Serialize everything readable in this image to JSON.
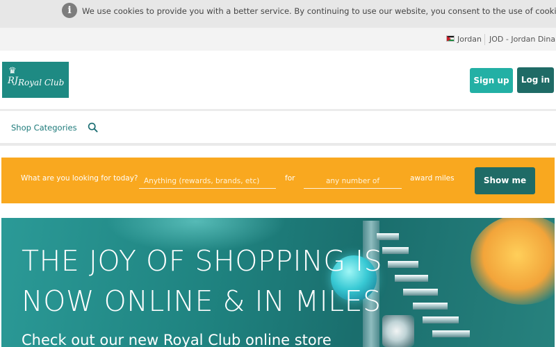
{
  "cookie_bar": {
    "icon": "info-icon",
    "text": "We use cookies to provide you with a better service. By continuing to use our website, you consent to the use of cookies."
  },
  "locale": {
    "country": "Jordan",
    "flag_icon": "jordan-flag-icon",
    "currency": "JOD - Jordan Dinars"
  },
  "header": {
    "logo_text": "Royal Club",
    "logo_monogram": "RJ",
    "signup_label": "Sign up",
    "login_label": "Log in"
  },
  "nav": {
    "shop_categories_label": "Shop Categories",
    "search_icon": "search-icon"
  },
  "search_bar": {
    "prompt": "What are you looking for today?",
    "query_placeholder": "Anything (rewards, brands, etc)",
    "for_label": "for",
    "miles_placeholder": "any number of",
    "miles_label": "award miles",
    "submit_label": "Show me"
  },
  "hero": {
    "title_line1": "THE JOY OF SHOPPING IS",
    "title_line2": "NOW ONLINE & IN MILES",
    "subtitle": "Check out our new Royal Club online store"
  },
  "colors": {
    "brand_teal": "#1e8a83",
    "dark_teal_button": "#1f6b66",
    "light_teal_button": "#23b0a5",
    "search_bar_orange": "#f9a81f",
    "nav_link": "#1d7a7a"
  }
}
